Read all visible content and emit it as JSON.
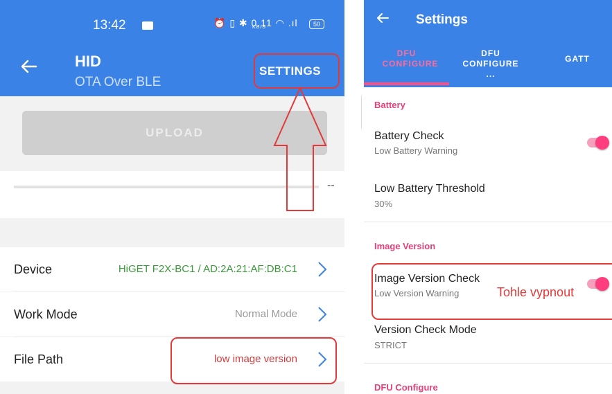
{
  "left_screen": {
    "status_bar": {
      "time": "13:42",
      "icons_text": "⏰ ▯ ✱ 0.11 ◠ .ıl",
      "net_speed_unit": "KB/S",
      "battery": "50"
    },
    "header": {
      "title": "HID",
      "subtitle": "OTA Over BLE",
      "settings_label": "SETTINGS"
    },
    "upload_button": "UPLOAD",
    "progress": {
      "value": 0,
      "text": "--"
    },
    "rows": [
      {
        "label": "Device",
        "value": "HiGET F2X-BC1 / AD:2A:21:AF:DB:C1",
        "value_color": "#3a9a3a"
      },
      {
        "label": "Work Mode",
        "value": "Normal Mode",
        "value_color": "#9a9a9a"
      },
      {
        "label": "File Path",
        "value": "low image version",
        "value_color": "#d63b3b"
      }
    ],
    "chevron_color": "#3b82e6"
  },
  "right_screen": {
    "header": {
      "title": "Settings"
    },
    "tabs": [
      {
        "label": "DFU CONFIGURE",
        "active": true
      },
      {
        "label": "DFU CONFIGURE ...",
        "active": false
      },
      {
        "label": "GATT",
        "active": false
      }
    ],
    "sections": {
      "battery": "Battery",
      "image_version": "Image Version",
      "dfu_configure": "DFU Configure"
    },
    "items": {
      "battery_check": {
        "title": "Battery Check",
        "subtitle": "Low Battery Warning",
        "enabled": true
      },
      "low_battery_threshold": {
        "title": "Low Battery Threshold",
        "subtitle": "30%"
      },
      "image_version_check": {
        "title": "Image Version Check",
        "subtitle": "Low Version Warning",
        "enabled": true
      },
      "version_check_mode": {
        "title": "Version Check Mode",
        "subtitle": "STRICT"
      }
    },
    "annotation": "Tohle vypnout"
  },
  "colors": {
    "primary": "#3b82e6",
    "accent": "#ff3d7f",
    "highlight": "#e23a3a"
  }
}
